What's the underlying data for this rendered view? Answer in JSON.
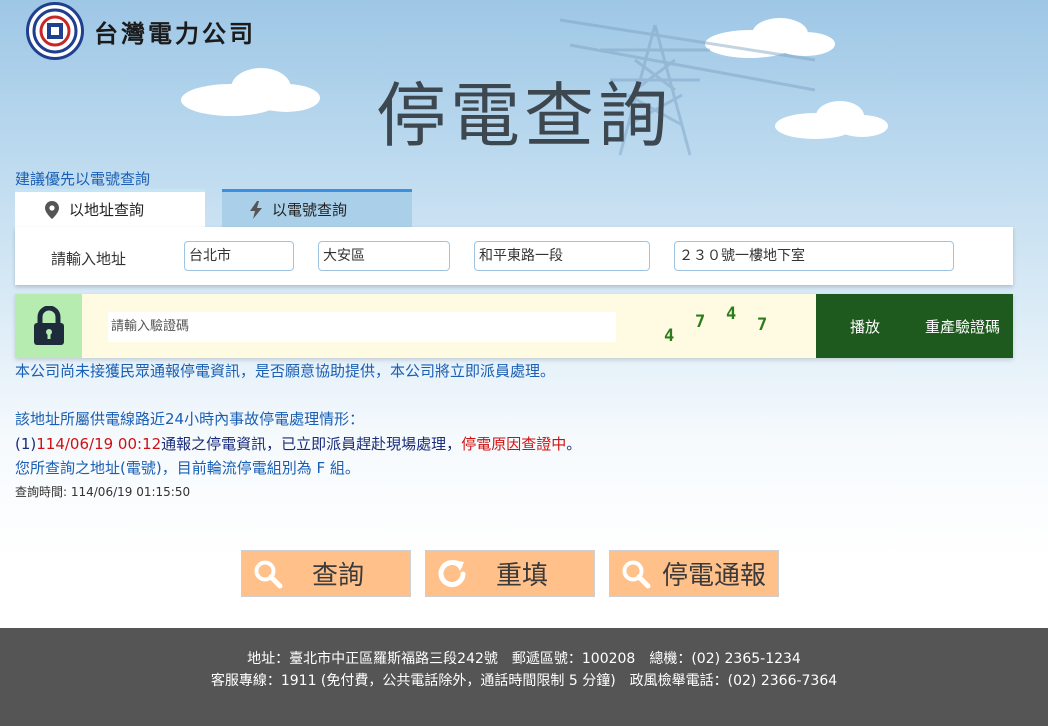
{
  "header": {
    "company_name": "台灣電力公司",
    "page_title": "停電查詢"
  },
  "hint": "建議優先以電號查詢",
  "tabs": [
    {
      "label": "以地址查詢",
      "icon": "map-pin-icon",
      "active": true
    },
    {
      "label": "以電號查詢",
      "icon": "lightning-icon",
      "active": false
    }
  ],
  "address_form": {
    "label": "請輸入地址",
    "city": "台北市",
    "district": "大安區",
    "road": "和平東路一段",
    "detail": "２３０號一樓地下室"
  },
  "captcha": {
    "placeholder": "請輸入驗證碼",
    "code": [
      "4",
      "7",
      "4",
      "7"
    ],
    "play_label": "播放",
    "regenerate_label": "重產驗證碼",
    "icon": "lock-icon"
  },
  "messages": {
    "not_reported": "本公司尚未接獲民眾通報停電資訊，是否願意協助提供，本公司將立即派員處理。",
    "circuit_heading": "該地址所屬供電線路近24小時內事故停電處理情形：",
    "item_prefix": "(1)",
    "item_time": "114/06/19 00:12",
    "item_text": "通報之停電資訊，已立即派員趕赴現場處理，",
    "item_status": "停電原因查證中",
    "item_end": "。",
    "rotation_group": "您所查詢之地址(電號)，目前輪流停電組別為 F 組。",
    "query_time": "查詢時間: 114/06/19 01:15:50"
  },
  "actions": [
    {
      "label": "查詢",
      "icon": "search-icon"
    },
    {
      "label": "重填",
      "icon": "refresh-icon"
    },
    {
      "label": "停電通報",
      "icon": "search-icon"
    }
  ],
  "footer": {
    "line1": "地址：臺北市中正區羅斯福路三段242號　郵遞區號：100208　總機：(02) 2365-1234",
    "line2": "客服專線：1911 (免付費，公共電話除外，通話時間限制 5 分鐘)　政風檢舉電話：(02) 2366-7364"
  },
  "colors": {
    "accent_blue": "#1a5fb4",
    "alert_red": "#d01010",
    "captcha_green": "#1e5a1d",
    "action_orange": "#ffc08a",
    "footer_gray": "#555555"
  }
}
